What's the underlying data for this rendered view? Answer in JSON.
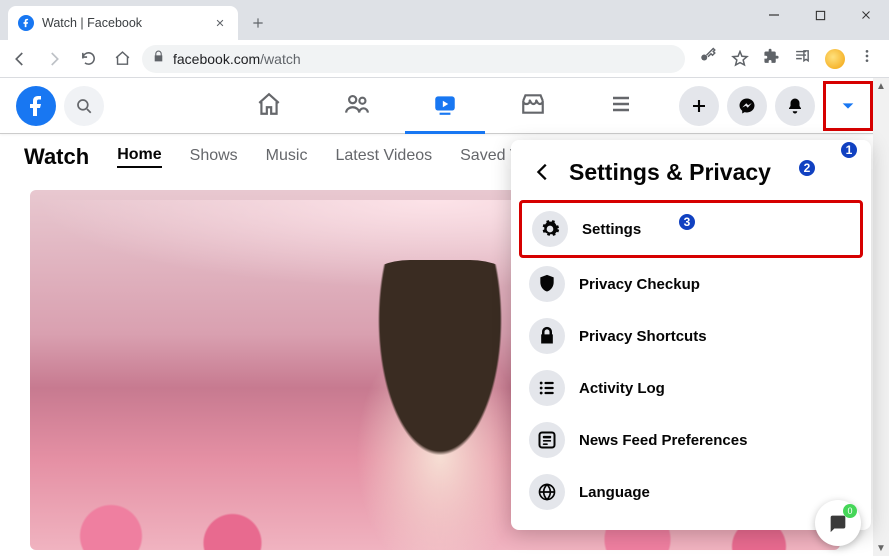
{
  "browser": {
    "tab_title": "Watch | Facebook",
    "url_host": "facebook.com",
    "url_path": "/watch"
  },
  "fb_nav": {
    "icons": [
      "home",
      "friends",
      "watch",
      "marketplace",
      "menu"
    ]
  },
  "watch": {
    "title": "Watch",
    "tabs": [
      "Home",
      "Shows",
      "Music",
      "Latest Videos",
      "Saved V"
    ]
  },
  "panel": {
    "title": "Settings & Privacy",
    "items": [
      {
        "icon": "gear",
        "label": "Settings"
      },
      {
        "icon": "lock-shield",
        "label": "Privacy Checkup"
      },
      {
        "icon": "lock",
        "label": "Privacy Shortcuts"
      },
      {
        "icon": "list",
        "label": "Activity Log"
      },
      {
        "icon": "feed",
        "label": "News Feed Preferences"
      },
      {
        "icon": "globe",
        "label": "Language"
      }
    ]
  },
  "callouts": {
    "one": "1",
    "two": "2",
    "three": "3"
  },
  "chat_badge": "0"
}
